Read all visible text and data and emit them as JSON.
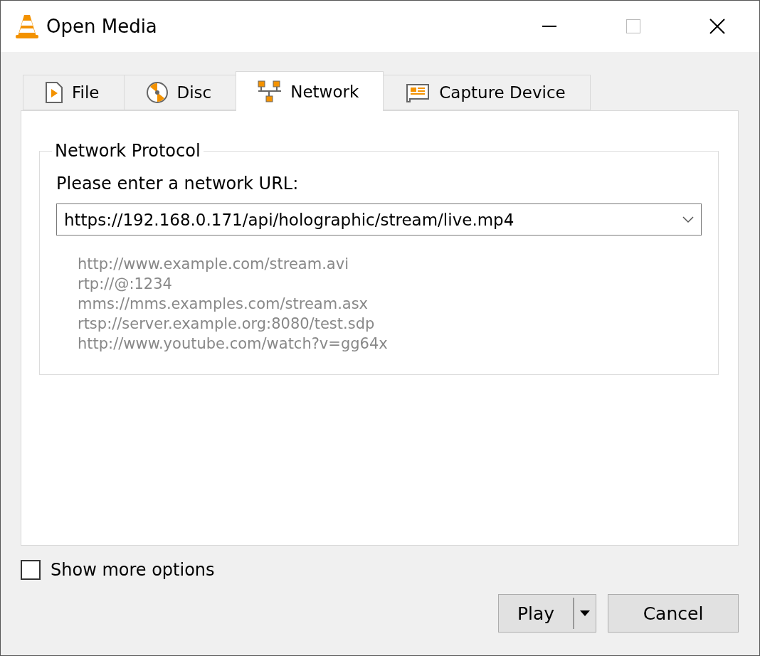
{
  "window": {
    "title": "Open Media"
  },
  "tabs": [
    {
      "label": "File",
      "kind": "file",
      "selected": false
    },
    {
      "label": "Disc",
      "kind": "disc",
      "selected": false
    },
    {
      "label": "Network",
      "kind": "network",
      "selected": true
    },
    {
      "label": "Capture Device",
      "kind": "capture",
      "selected": false
    }
  ],
  "group": {
    "title": "Network Protocol",
    "prompt": "Please enter a network URL:",
    "url": {
      "value": "https://192.168.0.171/api/holographic/stream/live.mp4"
    },
    "examples": [
      "http://www.example.com/stream.avi",
      "rtp://@:1234",
      "mms://mms.examples.com/stream.asx",
      "rtsp://server.example.org:8080/test.sdp",
      "http://www.youtube.com/watch?v=gg64x"
    ]
  },
  "show_more": {
    "label": "Show more options",
    "checked": false
  },
  "buttons": {
    "play": "Play",
    "cancel": "Cancel"
  }
}
